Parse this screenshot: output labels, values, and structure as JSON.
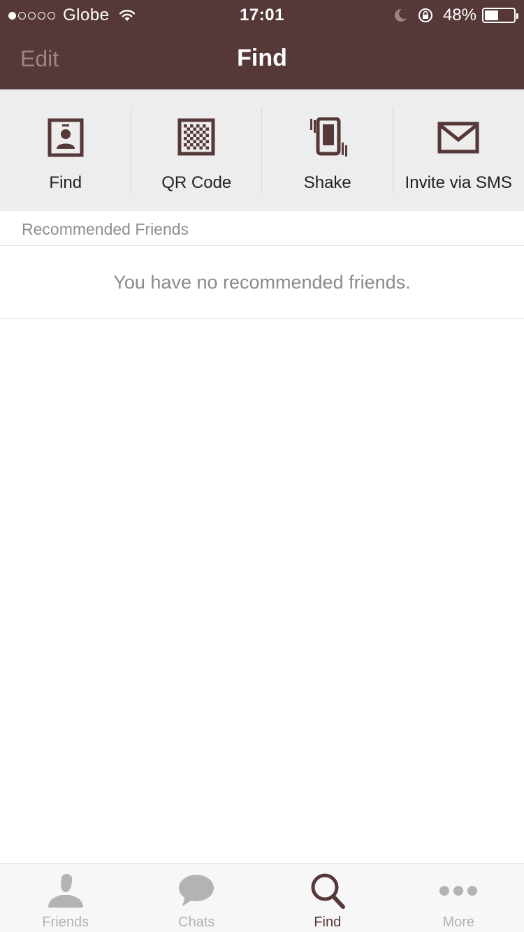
{
  "status_bar": {
    "signal_dots_filled": 1,
    "signal_dots_total": 5,
    "carrier": "Globe",
    "time": "17:01",
    "battery_percent_text": "48%",
    "battery_level": 0.48
  },
  "nav": {
    "edit_label": "Edit",
    "title": "Find"
  },
  "shortcuts": [
    {
      "label": "Find",
      "icon": "contact-card-icon"
    },
    {
      "label": "QR Code",
      "icon": "qr-code-icon"
    },
    {
      "label": "Shake",
      "icon": "shake-phone-icon"
    },
    {
      "label": "Invite via SMS",
      "icon": "envelope-icon"
    }
  ],
  "recommended": {
    "header": "Recommended Friends",
    "empty_message": "You have no recommended friends."
  },
  "tabbar": {
    "tabs": [
      {
        "label": "Friends",
        "icon": "person-icon",
        "active": false
      },
      {
        "label": "Chats",
        "icon": "chat-bubble-icon",
        "active": false
      },
      {
        "label": "Find",
        "icon": "search-icon",
        "active": true
      },
      {
        "label": "More",
        "icon": "more-dots-icon",
        "active": false
      }
    ]
  },
  "colors": {
    "header_bg": "#553837",
    "accent": "#553837",
    "inactive_tab": "#b3b3b3",
    "shortcut_bg": "#ededed"
  }
}
